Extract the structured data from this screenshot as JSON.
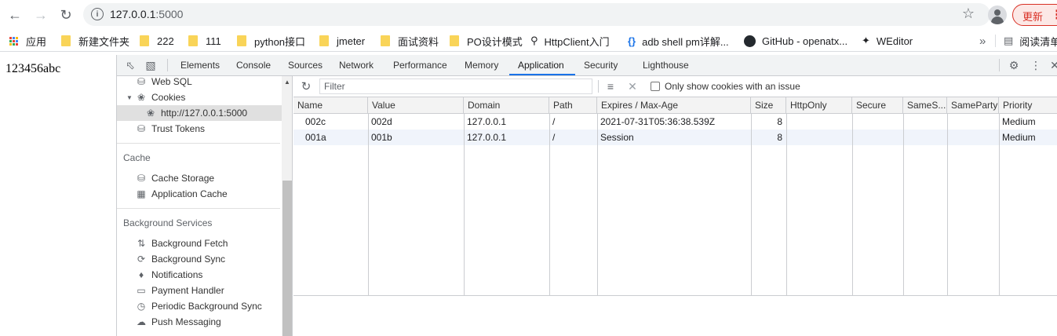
{
  "browser": {
    "url_host": "127.0.0.1",
    "url_port": ":5000",
    "update_label": "更新"
  },
  "bookmarks": [
    {
      "label": "应用",
      "icon": "apps-grid-icon"
    },
    {
      "label": "新建文件夹",
      "icon": "folder-icon"
    },
    {
      "label": "222",
      "icon": "folder-icon"
    },
    {
      "label": "111",
      "icon": "folder-icon"
    },
    {
      "label": "python接口",
      "icon": "folder-icon"
    },
    {
      "label": "jmeter",
      "icon": "folder-icon"
    },
    {
      "label": "面试资料",
      "icon": "folder-icon"
    },
    {
      "label": "PO设计模式",
      "icon": "folder-icon"
    },
    {
      "label": "HttpClient入门",
      "icon": "httpclient-icon"
    },
    {
      "label": "adb shell pm详解...",
      "icon": "braces-icon"
    },
    {
      "label": "GitHub - openatx...",
      "icon": "github-icon"
    },
    {
      "label": "WEditor",
      "icon": "weditor-icon"
    },
    {
      "label": "阅读清单",
      "icon": "reading-list-icon"
    }
  ],
  "page": {
    "text": "123456abc"
  },
  "devtools": {
    "tabs": [
      "Elements",
      "Console",
      "Sources",
      "Network",
      "Performance",
      "Memory",
      "Application",
      "Security",
      "Lighthouse"
    ],
    "active_tab": "Application",
    "sidebar": {
      "storage_items": [
        {
          "label": "Web SQL",
          "icon": "database-icon"
        },
        {
          "label": "Cookies",
          "icon": "cookie-icon",
          "expanded": true
        },
        {
          "label": "http://127.0.0.1:5000",
          "icon": "cookie-icon",
          "selected": true
        },
        {
          "label": "Trust Tokens",
          "icon": "database-icon"
        }
      ],
      "cache_heading": "Cache",
      "cache_items": [
        {
          "label": "Cache Storage",
          "icon": "database-icon"
        },
        {
          "label": "Application Cache",
          "icon": "grid-icon"
        }
      ],
      "background_heading": "Background Services",
      "background_items": [
        {
          "label": "Background Fetch",
          "icon": "arrows-updown-icon"
        },
        {
          "label": "Background Sync",
          "icon": "sync-icon"
        },
        {
          "label": "Notifications",
          "icon": "bell-icon"
        },
        {
          "label": "Payment Handler",
          "icon": "card-icon"
        },
        {
          "label": "Periodic Background Sync",
          "icon": "clock-icon"
        },
        {
          "label": "Push Messaging",
          "icon": "cloud-icon"
        }
      ]
    },
    "toolbar": {
      "filter_placeholder": "Filter",
      "only_issues_label": "Only show cookies with an issue"
    },
    "table": {
      "columns": [
        "Name",
        "Value",
        "Domain",
        "Path",
        "Expires / Max-Age",
        "Size",
        "HttpOnly",
        "Secure",
        "SameS...",
        "SameParty",
        "Priority"
      ],
      "rows": [
        [
          "002c",
          "002d",
          "127.0.0.1",
          "/",
          "2021-07-31T05:36:38.539Z",
          "8",
          "",
          "",
          "",
          "",
          "Medium"
        ],
        [
          "001a",
          "001b",
          "127.0.0.1",
          "/",
          "Session",
          "8",
          "",
          "",
          "",
          "",
          "Medium"
        ]
      ]
    }
  }
}
